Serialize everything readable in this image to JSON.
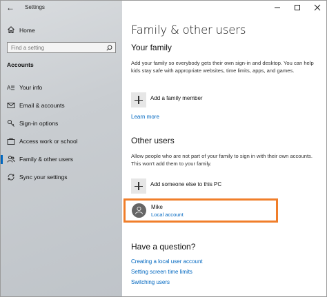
{
  "window": {
    "title": "Settings"
  },
  "sidebar": {
    "home_label": "Home",
    "search_placeholder": "Find a setting",
    "section_label": "Accounts",
    "items": [
      {
        "label": "Your info",
        "icon": "person-card-icon"
      },
      {
        "label": "Email & accounts",
        "icon": "mail-icon"
      },
      {
        "label": "Sign-in options",
        "icon": "key-icon"
      },
      {
        "label": "Access work or school",
        "icon": "briefcase-icon"
      },
      {
        "label": "Family & other users",
        "icon": "people-icon",
        "active": true
      },
      {
        "label": "Sync your settings",
        "icon": "sync-icon"
      }
    ]
  },
  "main": {
    "title": "Family & other users",
    "family": {
      "heading": "Your family",
      "description": "Add your family so everybody gets their own sign-in and desktop. You can help kids stay safe with appropriate websites, time limits, apps, and games.",
      "add_label": "Add a family member",
      "learn_more": "Learn more"
    },
    "other_users": {
      "heading": "Other users",
      "description": "Allow people who are not part of your family to sign in with their own accounts. This won't add them to your family.",
      "add_label": "Add someone else to this PC",
      "user": {
        "name": "Mike",
        "type": "Local account"
      }
    },
    "question": {
      "heading": "Have a question?",
      "links": [
        "Creating a local user account",
        "Setting screen time limits",
        "Switching users"
      ]
    }
  },
  "colors": {
    "accent": "#0067c0",
    "highlight": "#f07e2a"
  }
}
